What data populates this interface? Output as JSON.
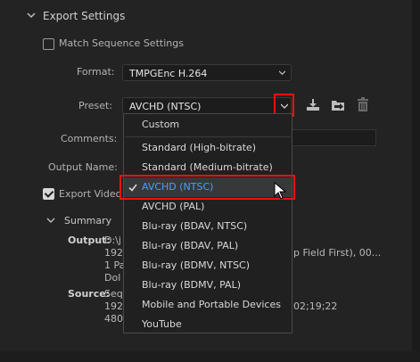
{
  "section": {
    "title": "Export Settings",
    "match_sequence_label": "Match Sequence Settings",
    "format_label": "Format:",
    "format_value": "TMPGEnc H.264",
    "preset_label": "Preset:",
    "preset_value": "AVCHD (NTSC)",
    "comments_label": "Comments:",
    "output_name_label": "Output Name:",
    "export_video_label": "Export Video"
  },
  "summary": {
    "title": "Summary",
    "output_label": "Output:",
    "output_lines": [
      "D:\\j",
      "192",
      "1 Pa",
      "Dol"
    ],
    "output_right": "p Field First), 00...",
    "source_label": "Source:",
    "source_lines": [
      "Seq",
      "192",
      "480"
    ],
    "source_right": "02;19;22"
  },
  "dropdown": {
    "items": [
      {
        "label": "Custom"
      },
      {
        "label": "Standard (High-bitrate)"
      },
      {
        "label": "Standard (Medium-bitrate)"
      },
      {
        "label": "AVCHD (NTSC)",
        "selected": true
      },
      {
        "label": "AVCHD (PAL)"
      },
      {
        "label": "Blu-ray (BDAV, NTSC)"
      },
      {
        "label": "Blu-ray (BDAV, PAL)"
      },
      {
        "label": "Blu-ray (BDMV, NTSC)"
      },
      {
        "label": "Blu-ray (BDMV, PAL)"
      },
      {
        "label": "Mobile and Portable Devices"
      },
      {
        "label": "YouTube"
      }
    ]
  },
  "colors": {
    "highlight_red": "#e11111",
    "selected_blue": "#4a9fff"
  },
  "icons": {
    "import_preset": "download-icon",
    "save_preset": "folder-import-icon",
    "delete_preset": "trash-icon"
  }
}
